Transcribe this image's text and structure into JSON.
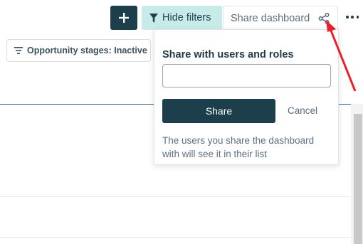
{
  "toolbar": {
    "add_icon": "plus-icon",
    "filters_label": "Hide filters",
    "filters_icon": "filter-funnel-icon",
    "share_label": "Share dashboard",
    "share_icon": "share-icon",
    "more_icon": "more-horizontal-icon"
  },
  "filter_chip": {
    "label": "Opportunity stages: Inactive",
    "icon": "filter-lines-icon"
  },
  "share_popover": {
    "title": "Share with users and roles",
    "input_value": "",
    "share_button": "Share",
    "cancel_button": "Cancel",
    "note": "The users you share the dashboard with will see it in their list"
  },
  "colors": {
    "primary": "#1d3f4c",
    "filters_bg": "#c6ebe9",
    "annotation_arrow": "#e8202a"
  }
}
